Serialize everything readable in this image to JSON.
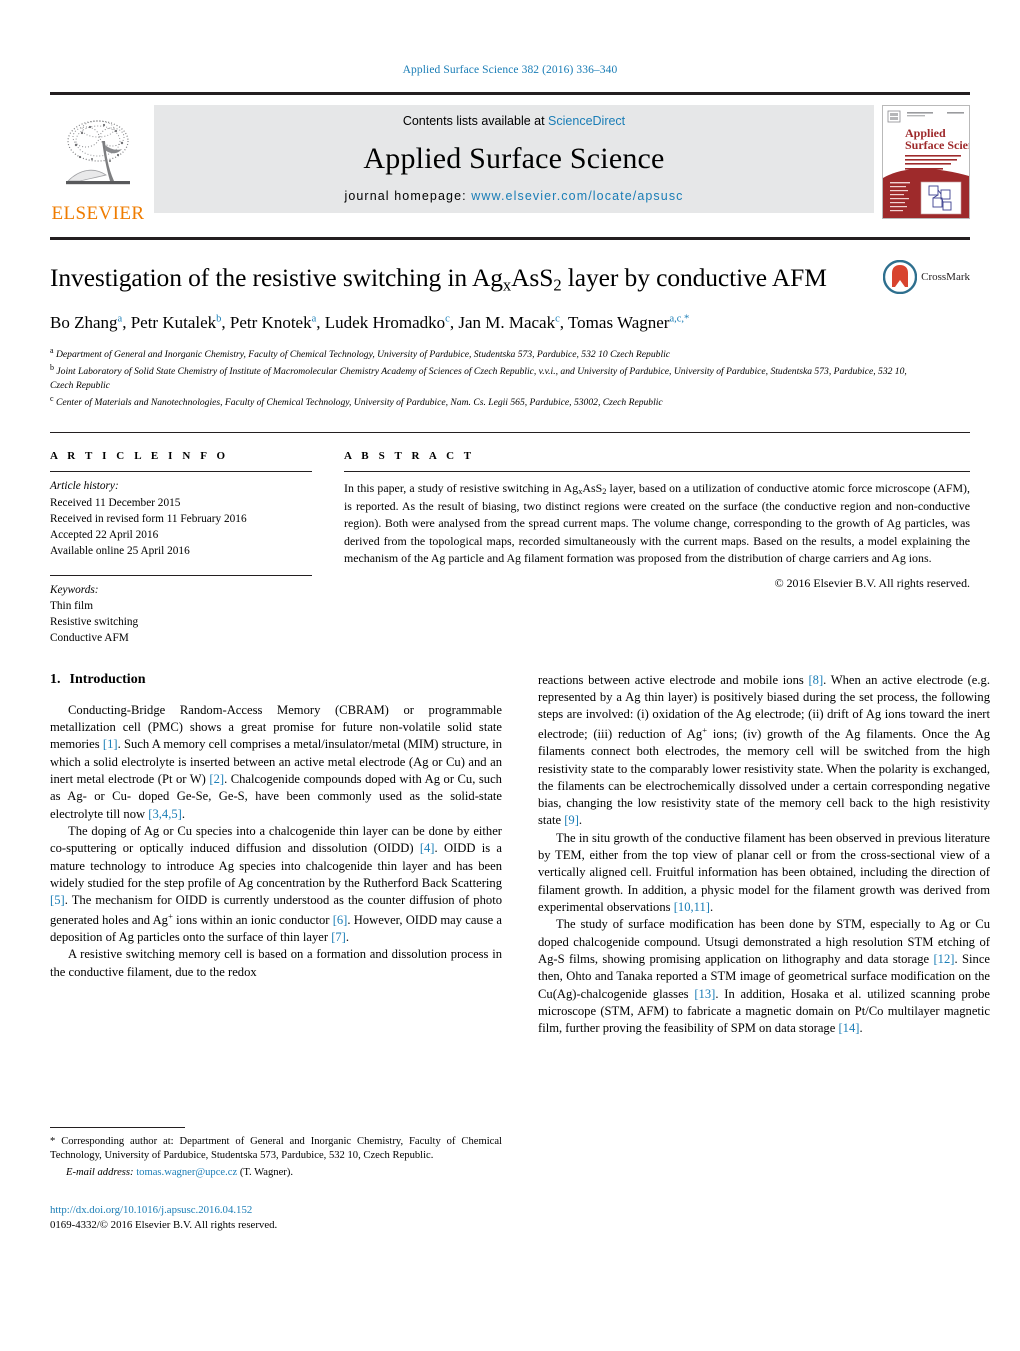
{
  "running_head": "Applied Surface Science 382 (2016) 336–340",
  "banner": {
    "publisher_name": "ELSEVIER",
    "contents_prefix": "Contents lists available at ",
    "contents_link": "ScienceDirect",
    "journal_title": "Applied Surface Science",
    "homepage_prefix": "journal homepage: ",
    "homepage_url": "www.elsevier.com/locate/apsusc",
    "cover_title_line1": "Applied",
    "cover_title_line2": "Surface Science"
  },
  "title": {
    "part1": "Investigation of the resistive switching in Ag",
    "sub1": "x",
    "part2": "AsS",
    "sub2": "2",
    "part3": " layer by conductive AFM"
  },
  "crossmark": {
    "label": "CrossMark"
  },
  "authors": [
    {
      "name": "Bo Zhang",
      "sup": "a",
      "sep": ", "
    },
    {
      "name": "Petr Kutalek",
      "sup": "b",
      "sep": ", "
    },
    {
      "name": "Petr Knotek",
      "sup": "a",
      "sep": ", "
    },
    {
      "name": "Ludek Hromadko",
      "sup": "c",
      "sep": ", "
    },
    {
      "name": "Jan M. Macak",
      "sup": "c",
      "sep": ", "
    },
    {
      "name": "Tomas Wagner",
      "sup": "a,c,*",
      "sep": ""
    }
  ],
  "affiliations": [
    {
      "mark": "a",
      "text": "Department of General and Inorganic Chemistry, Faculty of Chemical Technology, University of Pardubice, Studentska 573, Pardubice, 532 10 Czech Republic"
    },
    {
      "mark": "b",
      "text": "Joint Laboratory of Solid State Chemistry of Institute of Macromolecular Chemistry Academy of Sciences of Czech Republic, v.v.i., and University of Pardubice, University of Pardubice, Studentska 573, Pardubice, 532 10, Czech Republic"
    },
    {
      "mark": "c",
      "text": "Center of Materials and Nanotechnologies, Faculty of Chemical Technology, University of Pardubice, Nam. Cs. Legii 565, Pardubice, 53002, Czech Republic"
    }
  ],
  "article_info": {
    "heading": "A R T I C L E    I N F O",
    "history_label": "Article history:",
    "history": [
      "Received 11 December 2015",
      "Received in revised form 11 February 2016",
      "Accepted 22 April 2016",
      "Available online 25 April 2016"
    ],
    "keywords_label": "Keywords:",
    "keywords": [
      "Thin film",
      "Resistive switching",
      "Conductive AFM"
    ]
  },
  "abstract": {
    "heading": "A B S T R A C T",
    "text_before_sub": "In this paper, a study of resistive switching in Ag",
    "sub_x": "x",
    "text_mid": "AsS",
    "sub_2": "2",
    "text_after": " layer, based on a utilization of conductive atomic force microscope (AFM), is reported. As the result of biasing, two distinct regions were created on the surface (the conductive region and non-conductive region). Both were analysed from the spread current maps. The volume change, corresponding to the growth of Ag particles, was derived from the topological maps, recorded simultaneously with the current maps. Based on the results, a model explaining the mechanism of the Ag particle and Ag filament formation was proposed from the distribution of charge carriers and Ag ions.",
    "copyright": "© 2016 Elsevier B.V. All rights reserved."
  },
  "body": {
    "section_number": "1.",
    "section_title": "Introduction",
    "left_paragraphs": [
      {
        "runs": [
          {
            "t": "Conducting-Bridge Random-Access Memory (CBRAM) or programmable metallization cell (PMC) shows a great promise for future non-volatile solid state memories "
          },
          {
            "t": "[1]",
            "ref": true
          },
          {
            "t": ". Such A memory cell comprises a metal/insulator/metal (MIM) structure, in which a solid electrolyte is inserted between an active metal electrode (Ag or Cu) and an inert metal electrode (Pt or W) "
          },
          {
            "t": "[2]",
            "ref": true
          },
          {
            "t": ". Chalcogenide compounds doped with Ag or Cu, such as Ag- or Cu- doped Ge-Se, Ge-S, have been commonly used as the solid-state electrolyte till now "
          },
          {
            "t": "[3,4,5]",
            "ref": true
          },
          {
            "t": "."
          }
        ]
      },
      {
        "runs": [
          {
            "t": "The doping of Ag or Cu species into a chalcogenide thin layer can be done by either co-sputtering or optically induced diffusion and dissolution (OIDD) "
          },
          {
            "t": "[4]",
            "ref": true
          },
          {
            "t": ". OIDD is a mature technology to introduce Ag species into chalcogenide thin layer and has been widely studied for the step profile of Ag concentration by the Rutherford Back Scattering "
          },
          {
            "t": "[5]",
            "ref": true
          },
          {
            "t": ". The mechanism for OIDD is currently understood as the counter diffusion of photo generated holes and Ag"
          },
          {
            "t": "+",
            "sup": true
          },
          {
            "t": " ions within an ionic conductor "
          },
          {
            "t": "[6]",
            "ref": true
          },
          {
            "t": ". However, OIDD may cause a deposition of Ag particles onto the surface of thin layer "
          },
          {
            "t": "[7]",
            "ref": true
          },
          {
            "t": "."
          }
        ]
      },
      {
        "runs": [
          {
            "t": "A resistive switching memory cell is based on a formation and dissolution process in the conductive filament, due to the redox"
          }
        ]
      }
    ],
    "right_paragraphs": [
      {
        "first": true,
        "runs": [
          {
            "t": "reactions between active electrode and mobile ions "
          },
          {
            "t": "[8]",
            "ref": true
          },
          {
            "t": ". When an active electrode (e.g. represented by a Ag thin layer) is positively biased during the set process, the following steps are involved: (i) oxidation of the Ag electrode; (ii) drift of Ag ions toward the inert electrode; (iii) reduction of Ag"
          },
          {
            "t": "+",
            "sup": true
          },
          {
            "t": " ions; (iv) growth of the Ag filaments. Once the Ag filaments connect both electrodes, the memory cell will be switched from the high resistivity state to the comparably lower resistivity state. When the polarity is exchanged, the filaments can be electrochemically dissolved under a certain corresponding negative bias, changing the low resistivity state of the memory cell back to the high resistivity state "
          },
          {
            "t": "[9]",
            "ref": true
          },
          {
            "t": "."
          }
        ]
      },
      {
        "runs": [
          {
            "t": "The in situ growth of the conductive filament has been observed in previous literature by TEM, either from the top view of planar cell or from the cross-sectional view of a vertically aligned cell. Fruitful information has been obtained, including the direction of filament growth. In addition, a physic model for the filament growth was derived from experimental observations "
          },
          {
            "t": "[10,11]",
            "ref": true
          },
          {
            "t": "."
          }
        ]
      },
      {
        "runs": [
          {
            "t": "The study of surface modification has been done by STM, especially to Ag or Cu doped chalcogenide compound. Utsugi demonstrated a high resolution STM etching of Ag-S films, showing promising application on lithography and data storage "
          },
          {
            "t": "[12]",
            "ref": true
          },
          {
            "t": ". Since then, Ohto and Tanaka reported a STM image of geometrical surface modification on the Cu(Ag)-chalcogenide glasses "
          },
          {
            "t": "[13]",
            "ref": true
          },
          {
            "t": ". In addition, Hosaka et al. utilized scanning probe microscope (STM, AFM) to fabricate a magnetic domain on Pt/Co multilayer magnetic film, further proving the feasibility of SPM on data storage "
          },
          {
            "t": "[14]",
            "ref": true
          },
          {
            "t": "."
          }
        ]
      }
    ]
  },
  "footnotes": {
    "corresponding": "* Corresponding author at: Department of General and Inorganic Chemistry, Faculty of Chemical Technology, University of Pardubice, Studentska 573, Pardubice, 532 10, Czech Republic.",
    "email_label": "E-mail address:",
    "email": "tomas.wagner@upce.cz",
    "email_suffix": " (T. Wagner).",
    "doi": "http://dx.doi.org/10.1016/j.apsusc.2016.04.152",
    "issn_line": "0169-4332/© 2016 Elsevier B.V. All rights reserved."
  },
  "colors": {
    "link": "#1a7db6",
    "elsevier_orange": "#ef7c00",
    "rule": "#231f20",
    "banner_bg": "#e6e7e8",
    "cover_red": "#9e2a2b"
  }
}
